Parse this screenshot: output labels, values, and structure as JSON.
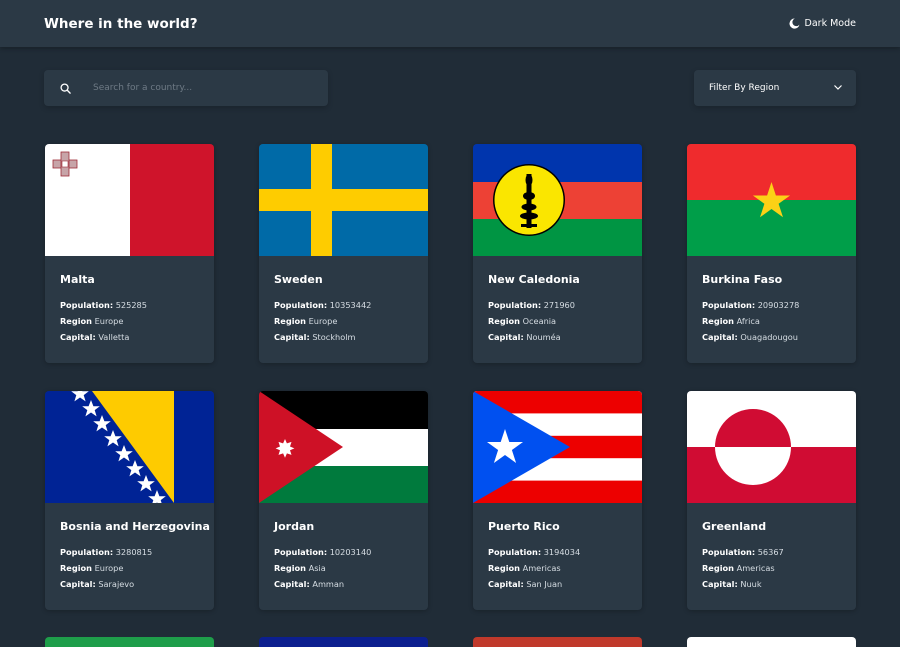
{
  "header": {
    "title": "Where in the world?",
    "mode_label": "Dark Mode"
  },
  "search": {
    "placeholder": "Search for a country...",
    "value": ""
  },
  "filter": {
    "label": "Filter By Region"
  },
  "labels": {
    "population": "Population:",
    "region": "Region",
    "capital": "Capital:"
  },
  "colors": {
    "background": "#202c37",
    "element": "#2b3945",
    "text": "#ffffff"
  },
  "countries": [
    {
      "name": "Malta",
      "population": "525285",
      "region": "Europe",
      "capital": "Valletta"
    },
    {
      "name": "Sweden",
      "population": "10353442",
      "region": "Europe",
      "capital": "Stockholm"
    },
    {
      "name": "New Caledonia",
      "population": "271960",
      "region": "Oceania",
      "capital": "Nouméa"
    },
    {
      "name": "Burkina Faso",
      "population": "20903278",
      "region": "Africa",
      "capital": "Ouagadougou"
    },
    {
      "name": "Bosnia and Herzegovina",
      "population": "3280815",
      "region": "Europe",
      "capital": "Sarajevo"
    },
    {
      "name": "Jordan",
      "population": "10203140",
      "region": "Asia",
      "capital": "Amman"
    },
    {
      "name": "Puerto Rico",
      "population": "3194034",
      "region": "Americas",
      "capital": "San Juan"
    },
    {
      "name": "Greenland",
      "population": "56367",
      "region": "Americas",
      "capital": "Nuuk"
    }
  ]
}
